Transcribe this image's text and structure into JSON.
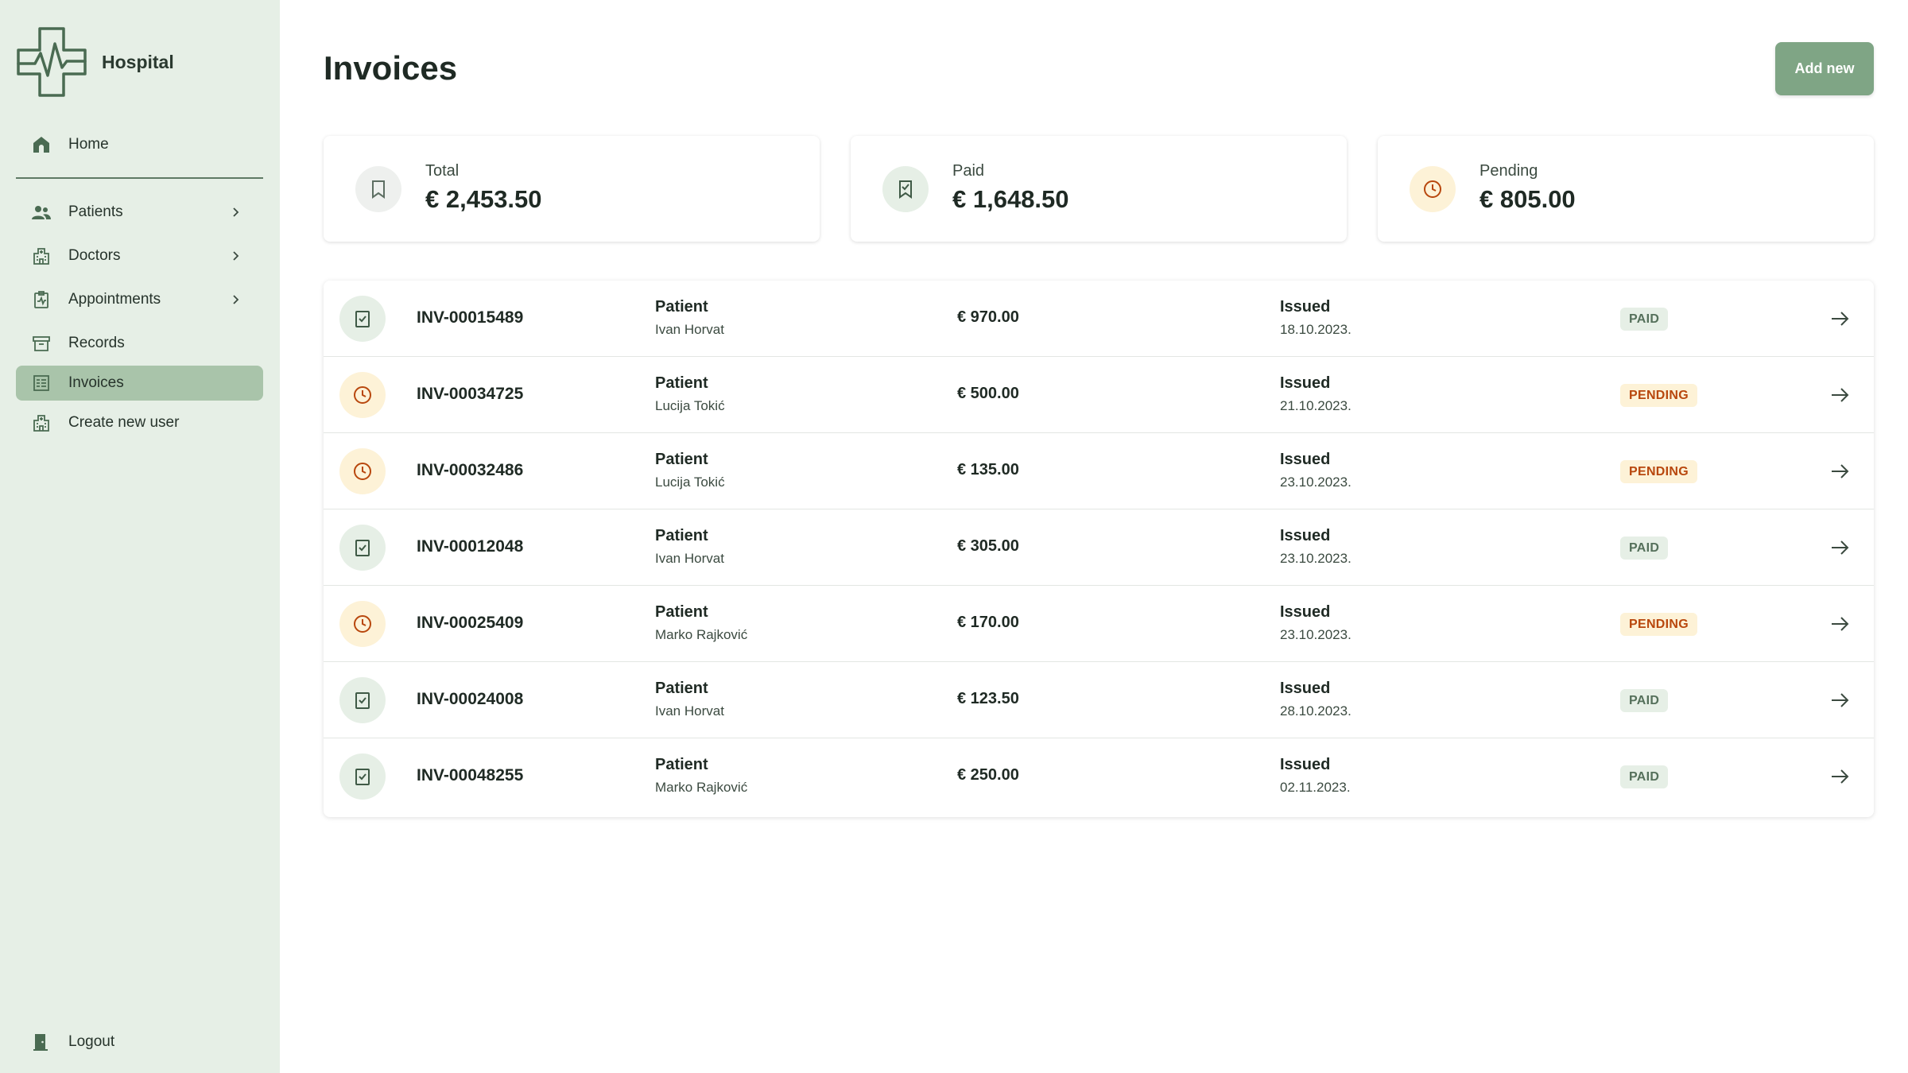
{
  "app": {
    "name": "Hospital"
  },
  "colors": {
    "accent": "#7fa585",
    "sidebar_bg": "#e6efe6",
    "active_nav": "#a9c4aa",
    "paid": "#55705b",
    "pending": "#b8470d"
  },
  "sidebar": {
    "items": [
      {
        "label": "Home",
        "icon": "home-icon"
      },
      {
        "label": "Patients",
        "icon": "users-icon",
        "expandable": true
      },
      {
        "label": "Doctors",
        "icon": "building-icon",
        "expandable": true
      },
      {
        "label": "Appointments",
        "icon": "calendar-clipboard-icon",
        "expandable": true
      },
      {
        "label": "Records",
        "icon": "archive-icon"
      },
      {
        "label": "Invoices",
        "icon": "receipt-icon",
        "active": true
      },
      {
        "label": "Create new user",
        "icon": "building-icon"
      }
    ],
    "logout_label": "Logout"
  },
  "page": {
    "title": "Invoices",
    "add_button": "Add new"
  },
  "stats": [
    {
      "label": "Total",
      "value": "€ 2,453.50",
      "icon": "receipt-icon"
    },
    {
      "label": "Paid",
      "value": "€ 1,648.50",
      "icon": "receipt-check-icon"
    },
    {
      "label": "Pending",
      "value": "€ 805.00",
      "icon": "clock-icon"
    }
  ],
  "invoices": [
    {
      "id": "INV-00015489",
      "patient_label": "Patient",
      "patient": "Ivan Horvat",
      "amount": "€ 970.00",
      "issued_label": "Issued",
      "date": "18.10.2023.",
      "status": "PAID"
    },
    {
      "id": "INV-00034725",
      "patient_label": "Patient",
      "patient": "Lucija Tokić",
      "amount": "€ 500.00",
      "issued_label": "Issued",
      "date": "21.10.2023.",
      "status": "PENDING"
    },
    {
      "id": "INV-00032486",
      "patient_label": "Patient",
      "patient": "Lucija Tokić",
      "amount": "€ 135.00",
      "issued_label": "Issued",
      "date": "23.10.2023.",
      "status": "PENDING"
    },
    {
      "id": "INV-00012048",
      "patient_label": "Patient",
      "patient": "Ivan Horvat",
      "amount": "€ 305.00",
      "issued_label": "Issued",
      "date": "23.10.2023.",
      "status": "PAID"
    },
    {
      "id": "INV-00025409",
      "patient_label": "Patient",
      "patient": "Marko Rajković",
      "amount": "€ 170.00",
      "issued_label": "Issued",
      "date": "23.10.2023.",
      "status": "PENDING"
    },
    {
      "id": "INV-00024008",
      "patient_label": "Patient",
      "patient": "Ivan Horvat",
      "amount": "€ 123.50",
      "issued_label": "Issued",
      "date": "28.10.2023.",
      "status": "PAID"
    },
    {
      "id": "INV-00048255",
      "patient_label": "Patient",
      "patient": "Marko Rajković",
      "amount": "€ 250.00",
      "issued_label": "Issued",
      "date": "02.11.2023.",
      "status": "PAID"
    }
  ]
}
